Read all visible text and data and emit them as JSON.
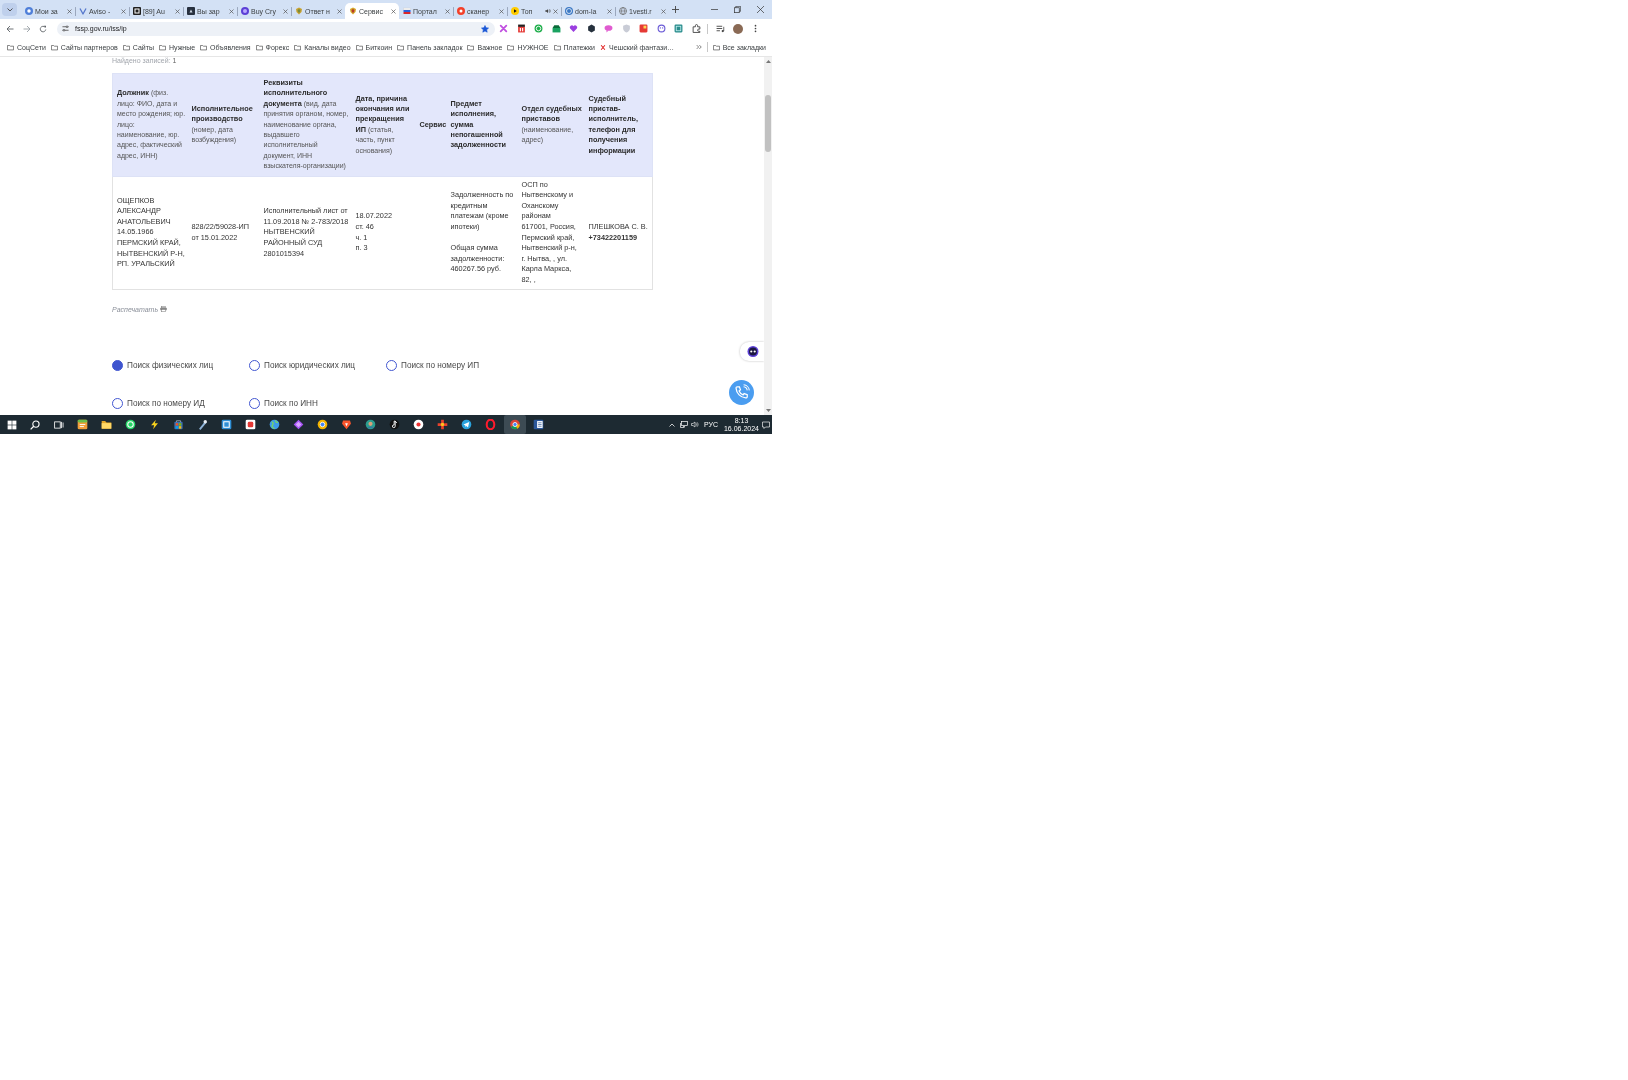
{
  "browser": {
    "tabs": [
      {
        "title": "Мои за",
        "selected": false,
        "audio": false
      },
      {
        "title": "Aviso -",
        "selected": false,
        "audio": false
      },
      {
        "title": "[89] Au",
        "selected": false,
        "audio": false
      },
      {
        "title": "Вы зар",
        "selected": false,
        "audio": false
      },
      {
        "title": "Buy Cry",
        "selected": false,
        "audio": false
      },
      {
        "title": "Ответ н",
        "selected": false,
        "audio": false
      },
      {
        "title": "Сервис",
        "selected": true,
        "audio": false
      },
      {
        "title": "Портал",
        "selected": false,
        "audio": false
      },
      {
        "title": "сканер",
        "selected": false,
        "audio": false
      },
      {
        "title": "Топ",
        "selected": false,
        "audio": true
      },
      {
        "title": "dom-la",
        "selected": false,
        "audio": false
      },
      {
        "title": "1vesti.r",
        "selected": false,
        "audio": false
      }
    ],
    "address": "fssp.gov.ru/iss/ip",
    "bookmarked": true,
    "bookmarks": [
      {
        "label": "СоцСети",
        "kind": "folder"
      },
      {
        "label": "Сайты партнеров",
        "kind": "folder"
      },
      {
        "label": "Сайты",
        "kind": "folder"
      },
      {
        "label": "Нужные",
        "kind": "folder"
      },
      {
        "label": "Объявления",
        "kind": "folder"
      },
      {
        "label": "Форекс",
        "kind": "folder"
      },
      {
        "label": "Каналы видео",
        "kind": "folder"
      },
      {
        "label": "Биткоин",
        "kind": "folder"
      },
      {
        "label": "Панель закладок",
        "kind": "folder"
      },
      {
        "label": "Важное",
        "kind": "folder"
      },
      {
        "label": "НУЖНОЕ",
        "kind": "folder"
      },
      {
        "label": "Платежки",
        "kind": "folder"
      },
      {
        "label": "Чешский фантази…",
        "kind": "page"
      }
    ],
    "all_bookmarks": "Все закладки"
  },
  "page": {
    "found_label": "Найдено записей:",
    "found_count": "1",
    "table": {
      "columns": [
        {
          "title": "Должник",
          "note": "(физ. лицо: ФИО, дата и место рождения; юр. лицо: наименование, юр. адрес, фактический адрес, ИНН)"
        },
        {
          "title": "Исполнительное производство",
          "note": "(номер, дата возбуждения)"
        },
        {
          "title": "Реквизиты исполнительного документа",
          "note": "(вид, дата принятия органом, номер, наименование органа, выдавшего исполнительный документ, ИНН взыскателя-организации)"
        },
        {
          "title": "Дата, причина окончания или прекращения ИП",
          "note": "(статья, часть, пункт основания)"
        },
        {
          "title": "Сервис"
        },
        {
          "title": "Предмет исполнения, сумма непогашенной задолженности"
        },
        {
          "title": "Отдел судебных приставов",
          "note": "(наименование, адрес)"
        },
        {
          "title": "Судебный пристав-исполнитель, телефон для получения информации"
        }
      ],
      "rows": [
        {
          "debtor": "ОЩЕПКОВ АЛЕКСАНДР АНАТОЛЬЕВИЧ\n14.05.1966\nПЕРМСКИЙ КРАЙ, НЫТВЕНСКИЙ Р-Н, РП. УРАЛЬСКИЙ",
          "proceeding": "828/22/59028-ИП\nот 15.01.2022",
          "document": "Исполнительный лист от 11.09.2018 № 2-783/2018\nНЫТВЕНСКИЙ РАЙОННЫЙ СУД\n2801015394",
          "ending": "18.07.2022\nст. 46\nч. 1\nп. 3",
          "subject": "Задолженность по кредитным платежам (кроме ипотеки)\n\nОбщая сумма задолженности: 460267.56 руб.",
          "department": "ОСП по Нытвенскому и Оханскому районам\n617001, Россия, Пермский край, Нытвенский р-н, г. Нытва, , ул. Карла Маркса, 82, ,",
          "bailiff": "ПЛЕШКОВА С. В.\n**+73422201159**"
        }
      ]
    },
    "print_link": "Распечатать",
    "search_modes": [
      {
        "label": "Поиск физических лиц",
        "selected": true
      },
      {
        "label": "Поиск юридических лиц",
        "selected": false
      },
      {
        "label": "Поиск по номеру ИП",
        "selected": false
      },
      {
        "label": "Поиск по номеру ИД",
        "selected": false
      },
      {
        "label": "Поиск по ИНН",
        "selected": false
      }
    ]
  },
  "taskbar": {
    "apps": [
      {
        "selected": false
      },
      {
        "selected": false
      },
      {
        "selected": false
      },
      {
        "selected": false
      },
      {
        "selected": false
      },
      {
        "selected": false
      },
      {
        "selected": false
      },
      {
        "selected": false
      },
      {
        "selected": false
      },
      {
        "selected": false
      },
      {
        "selected": false
      },
      {
        "selected": false
      },
      {
        "selected": false
      },
      {
        "selected": false
      },
      {
        "selected": false
      },
      {
        "selected": false
      },
      {
        "selected": false
      },
      {
        "selected": false
      },
      {
        "selected": true
      },
      {
        "selected": false
      }
    ],
    "language": "РУС",
    "time": "8:13",
    "date": "16.06.2024"
  }
}
